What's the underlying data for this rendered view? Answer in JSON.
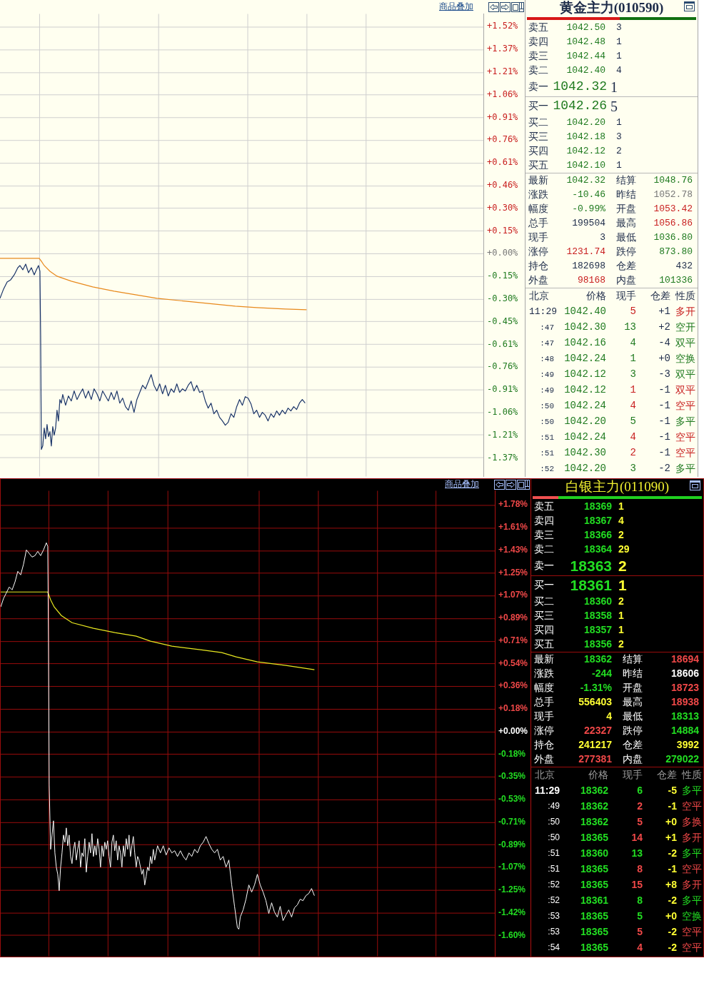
{
  "panels": [
    {
      "kind": "light",
      "toolbar": {
        "link": "商品叠加"
      },
      "axis_labels": [
        {
          "text": "+1.52%",
          "color": "#c81e1e"
        },
        {
          "text": "+1.37%",
          "color": "#c81e1e"
        },
        {
          "text": "+1.21%",
          "color": "#c81e1e"
        },
        {
          "text": "+1.06%",
          "color": "#c81e1e"
        },
        {
          "text": "+0.91%",
          "color": "#c81e1e"
        },
        {
          "text": "+0.76%",
          "color": "#c81e1e"
        },
        {
          "text": "+0.61%",
          "color": "#c81e1e"
        },
        {
          "text": "+0.46%",
          "color": "#c81e1e"
        },
        {
          "text": "+0.30%",
          "color": "#c81e1e"
        },
        {
          "text": "+0.15%",
          "color": "#c81e1e"
        },
        {
          "text": "+0.00%",
          "color": "#787878"
        },
        {
          "text": "-0.15%",
          "color": "#1f7a1f"
        },
        {
          "text": "-0.30%",
          "color": "#1f7a1f"
        },
        {
          "text": "-0.45%",
          "color": "#1f7a1f"
        },
        {
          "text": "-0.61%",
          "color": "#1f7a1f"
        },
        {
          "text": "-0.76%",
          "color": "#1f7a1f"
        },
        {
          "text": "-0.91%",
          "color": "#1f7a1f"
        },
        {
          "text": "-1.06%",
          "color": "#1f7a1f"
        },
        {
          "text": "-1.21%",
          "color": "#1f7a1f"
        },
        {
          "text": "-1.37%",
          "color": "#1f7a1f"
        }
      ],
      "quote": {
        "title": "黄金主力(010590)",
        "ratio_bar": {
          "level": 0.55
        },
        "asks": [
          {
            "label": "卖五",
            "price": "1042.50",
            "volume": "3",
            "kind": "depth"
          },
          {
            "label": "卖四",
            "price": "1042.48",
            "volume": "1",
            "kind": "depth"
          },
          {
            "label": "卖三",
            "price": "1042.44",
            "volume": "1",
            "kind": "depth"
          },
          {
            "label": "卖二",
            "price": "1042.40",
            "volume": "4",
            "kind": "depth"
          },
          {
            "label": "卖一",
            "price": "1042.32",
            "volume": "1",
            "kind": "best"
          }
        ],
        "bids": [
          {
            "label": "买一",
            "price": "1042.26",
            "volume": "5",
            "kind": "best"
          },
          {
            "label": "买二",
            "price": "1042.20",
            "volume": "1",
            "kind": "depth"
          },
          {
            "label": "买三",
            "price": "1042.18",
            "volume": "3",
            "kind": "depth"
          },
          {
            "label": "买四",
            "price": "1042.12",
            "volume": "2",
            "kind": "depth"
          },
          {
            "label": "买五",
            "price": "1042.10",
            "volume": "1",
            "kind": "depth"
          }
        ],
        "stats": [
          {
            "label": "最新",
            "value": "1042.32",
            "color": "#1f7a1f"
          },
          {
            "label": "结算",
            "value": "1048.76",
            "color": "#1f7a1f"
          },
          {
            "label": "涨跌",
            "value": "-10.46",
            "color": "#1f7a1f"
          },
          {
            "label": "昨结",
            "value": "1052.78",
            "color": "#787878"
          },
          {
            "label": "幅度",
            "value": "-0.99%",
            "color": "#1f7a1f"
          },
          {
            "label": "开盘",
            "value": "1053.42",
            "color": "#c81e1e"
          },
          {
            "label": "总手",
            "value": "199504",
            "color": "#1c2a48"
          },
          {
            "label": "最高",
            "value": "1056.86",
            "color": "#c81e1e"
          },
          {
            "label": "现手",
            "value": "3",
            "color": "#1c2a48"
          },
          {
            "label": "最低",
            "value": "1036.80",
            "color": "#1f7a1f"
          },
          {
            "label": "涨停",
            "value": "1231.74",
            "color": "#c81e1e"
          },
          {
            "label": "跌停",
            "value": "873.80",
            "color": "#1f7a1f"
          },
          {
            "label": "持仓",
            "value": "182698",
            "color": "#1c2a48"
          },
          {
            "label": "仓差",
            "value": "432",
            "color": "#1c2a48"
          },
          {
            "label": "外盘",
            "value": "98168",
            "color": "#c81e1e"
          },
          {
            "label": "内盘",
            "value": "101336",
            "color": "#1f7a1f"
          }
        ],
        "ticks": {
          "columns": [
            "北京",
            "价格",
            "现手",
            "仓差",
            "性质"
          ],
          "rows": [
            {
              "time": "11:29",
              "price": "1042.40",
              "volume": "5",
              "change": "+1",
              "nature": "多开",
              "color": "#c81e1e"
            },
            {
              "time": ":47",
              "price": "1042.30",
              "volume": "13",
              "change": "+2",
              "nature": "空开",
              "color": "#1f7a1f"
            },
            {
              "time": ":47",
              "price": "1042.16",
              "volume": "4",
              "change": "-4",
              "nature": "双平",
              "color": "#1f7a1f"
            },
            {
              "time": ":48",
              "price": "1042.24",
              "volume": "1",
              "change": "+0",
              "nature": "空换",
              "color": "#1f7a1f"
            },
            {
              "time": ":49",
              "price": "1042.12",
              "volume": "3",
              "change": "-3",
              "nature": "双平",
              "color": "#1f7a1f"
            },
            {
              "time": ":49",
              "price": "1042.12",
              "volume": "1",
              "change": "-1",
              "nature": "双平",
              "color": "#c81e1e"
            },
            {
              "time": ":50",
              "price": "1042.24",
              "volume": "4",
              "change": "-1",
              "nature": "空平",
              "color": "#c81e1e"
            },
            {
              "time": ":50",
              "price": "1042.20",
              "volume": "5",
              "change": "-1",
              "nature": "多平",
              "color": "#1f7a1f"
            },
            {
              "time": ":51",
              "price": "1042.24",
              "volume": "4",
              "change": "-1",
              "nature": "空平",
              "color": "#c81e1e"
            },
            {
              "time": ":51",
              "price": "1042.30",
              "volume": "2",
              "change": "-1",
              "nature": "空平",
              "color": "#c81e1e"
            },
            {
              "time": ":52",
              "price": "1042.20",
              "volume": "3",
              "change": "-2",
              "nature": "多平",
              "color": "#1f7a1f"
            }
          ]
        }
      }
    },
    {
      "kind": "dark",
      "toolbar": {
        "link": "商品叠加"
      },
      "axis_labels": [
        {
          "text": "+1.78%",
          "color": "#f04848"
        },
        {
          "text": "+1.61%",
          "color": "#f04848"
        },
        {
          "text": "+1.43%",
          "color": "#f04848"
        },
        {
          "text": "+1.25%",
          "color": "#f04848"
        },
        {
          "text": "+1.07%",
          "color": "#f04848"
        },
        {
          "text": "+0.89%",
          "color": "#f04848"
        },
        {
          "text": "+0.71%",
          "color": "#f04848"
        },
        {
          "text": "+0.54%",
          "color": "#f04848"
        },
        {
          "text": "+0.36%",
          "color": "#f04848"
        },
        {
          "text": "+0.18%",
          "color": "#f04848"
        },
        {
          "text": "+0.00%",
          "color": "#ffffff"
        },
        {
          "text": "-0.18%",
          "color": "#22dd22"
        },
        {
          "text": "-0.35%",
          "color": "#22dd22"
        },
        {
          "text": "-0.53%",
          "color": "#22dd22"
        },
        {
          "text": "-0.71%",
          "color": "#22dd22"
        },
        {
          "text": "-0.89%",
          "color": "#22dd22"
        },
        {
          "text": "-1.07%",
          "color": "#22dd22"
        },
        {
          "text": "-1.25%",
          "color": "#22dd22"
        },
        {
          "text": "-1.42%",
          "color": "#22dd22"
        },
        {
          "text": "-1.60%",
          "color": "#22dd22"
        }
      ],
      "quote": {
        "title": "白银主力(011090)",
        "ratio_bar": {
          "level": 0.15
        },
        "asks": [
          {
            "label": "卖五",
            "price": "18369",
            "volume": "1",
            "kind": "depth"
          },
          {
            "label": "卖四",
            "price": "18367",
            "volume": "4",
            "kind": "depth"
          },
          {
            "label": "卖三",
            "price": "18366",
            "volume": "2",
            "kind": "depth"
          },
          {
            "label": "卖二",
            "price": "18364",
            "volume": "29",
            "kind": "depth"
          },
          {
            "label": "卖一",
            "price": "18363",
            "volume": "2",
            "kind": "best"
          }
        ],
        "bids": [
          {
            "label": "买一",
            "price": "18361",
            "volume": "1",
            "kind": "best"
          },
          {
            "label": "买二",
            "price": "18360",
            "volume": "2",
            "kind": "depth"
          },
          {
            "label": "买三",
            "price": "18358",
            "volume": "1",
            "kind": "depth"
          },
          {
            "label": "买四",
            "price": "18357",
            "volume": "1",
            "kind": "depth"
          },
          {
            "label": "买五",
            "price": "18356",
            "volume": "2",
            "kind": "depth"
          }
        ],
        "stats": [
          {
            "label": "最新",
            "value": "18362",
            "color": "#22dd22"
          },
          {
            "label": "结算",
            "value": "18694",
            "color": "#f04848"
          },
          {
            "label": "涨跌",
            "value": "-244",
            "color": "#22dd22"
          },
          {
            "label": "昨结",
            "value": "18606",
            "color": "#ffffff"
          },
          {
            "label": "幅度",
            "value": "-1.31%",
            "color": "#22dd22"
          },
          {
            "label": "开盘",
            "value": "18723",
            "color": "#f04848"
          },
          {
            "label": "总手",
            "value": "556403",
            "color": "#ffff33"
          },
          {
            "label": "最高",
            "value": "18938",
            "color": "#f04848"
          },
          {
            "label": "现手",
            "value": "4",
            "color": "#ffff33"
          },
          {
            "label": "最低",
            "value": "18313",
            "color": "#22dd22"
          },
          {
            "label": "涨停",
            "value": "22327",
            "color": "#f04848"
          },
          {
            "label": "跌停",
            "value": "14884",
            "color": "#22dd22"
          },
          {
            "label": "持仓",
            "value": "241217",
            "color": "#ffff33"
          },
          {
            "label": "仓差",
            "value": "3992",
            "color": "#ffff33"
          },
          {
            "label": "外盘",
            "value": "277381",
            "color": "#f04848"
          },
          {
            "label": "内盘",
            "value": "279022",
            "color": "#22dd22"
          }
        ],
        "ticks": {
          "columns": [
            "北京",
            "价格",
            "现手",
            "仓差",
            "性质"
          ],
          "rows": [
            {
              "time": "11:29",
              "price": "18362",
              "volume": "6",
              "change": "-5",
              "nature": "多平",
              "color": "#22dd22"
            },
            {
              "time": ":49",
              "price": "18362",
              "volume": "2",
              "change": "-1",
              "nature": "空平",
              "color": "#f04848"
            },
            {
              "time": ":50",
              "price": "18362",
              "volume": "5",
              "change": "+0",
              "nature": "多换",
              "color": "#f04848"
            },
            {
              "time": ":50",
              "price": "18365",
              "volume": "14",
              "change": "+1",
              "nature": "多开",
              "color": "#f04848"
            },
            {
              "time": ":51",
              "price": "18360",
              "volume": "13",
              "change": "-2",
              "nature": "多平",
              "color": "#22dd22"
            },
            {
              "time": ":51",
              "price": "18365",
              "volume": "8",
              "change": "-1",
              "nature": "空平",
              "color": "#f04848"
            },
            {
              "time": ":52",
              "price": "18365",
              "volume": "15",
              "change": "+8",
              "nature": "多开",
              "color": "#f04848"
            },
            {
              "time": ":52",
              "price": "18361",
              "volume": "8",
              "change": "-2",
              "nature": "多平",
              "color": "#22dd22"
            },
            {
              "time": ":53",
              "price": "18365",
              "volume": "5",
              "change": "+0",
              "nature": "空换",
              "color": "#22dd22"
            },
            {
              "time": ":53",
              "price": "18365",
              "volume": "5",
              "change": "-2",
              "nature": "空平",
              "color": "#f04848"
            },
            {
              "time": ":54",
              "price": "18365",
              "volume": "4",
              "change": "-2",
              "nature": "空平",
              "color": "#f04848"
            }
          ]
        }
      }
    }
  ]
}
